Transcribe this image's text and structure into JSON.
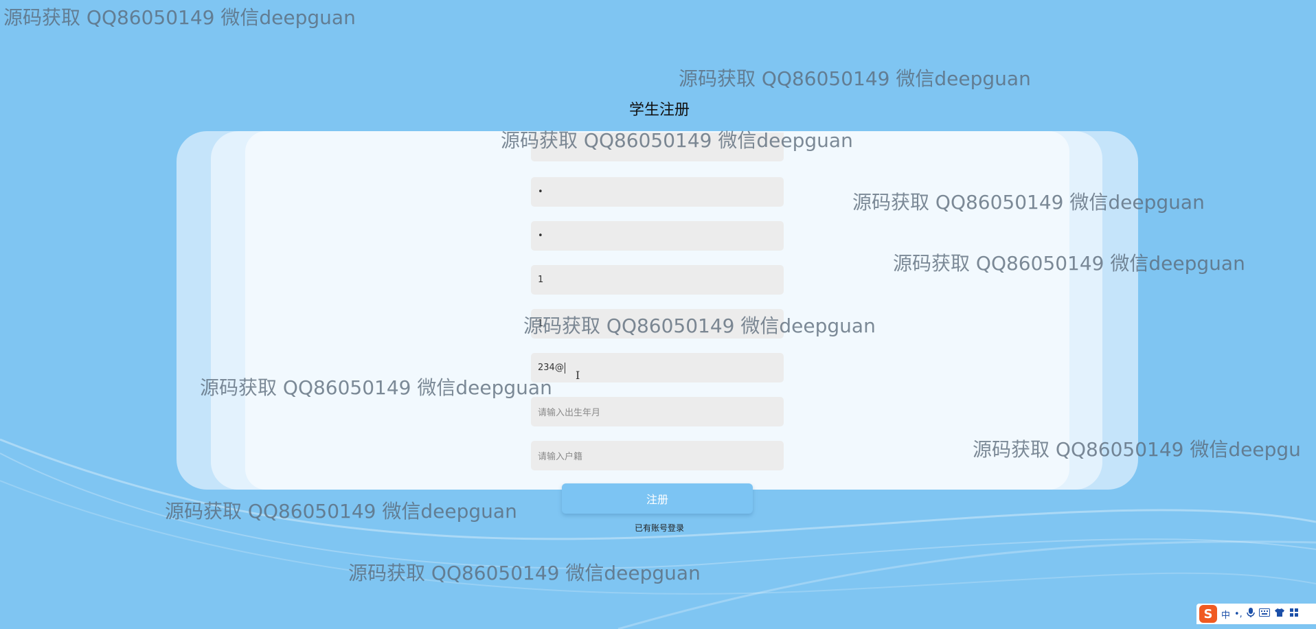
{
  "page": {
    "title": "学生注册"
  },
  "form": {
    "fields": [
      {
        "value": "",
        "placeholder": ""
      },
      {
        "value": "•",
        "placeholder": ""
      },
      {
        "value": "•",
        "placeholder": ""
      },
      {
        "value": "1",
        "placeholder": ""
      },
      {
        "value": "1",
        "placeholder": ""
      },
      {
        "value": "234@",
        "placeholder": ""
      },
      {
        "value": "",
        "placeholder": "请输入出生年月"
      },
      {
        "value": "",
        "placeholder": "请输入户籍"
      }
    ],
    "submit_label": "注册",
    "login_link": "已有账号登录"
  },
  "watermark": {
    "text": "源码获取 QQ86050149 微信deepguan",
    "text_cut": "源码获取 QQ86050149 微信deepgu"
  },
  "tray": {
    "ime_logo": "S",
    "ime_mode": "中",
    "punct": "•,",
    "mic_icon": "microphone-icon",
    "keyboard_icon": "keyboard-icon",
    "skin_icon": "shirt-icon",
    "menu_icon": "grid-icon"
  },
  "colors": {
    "background": "#7fc5f2",
    "button": "#7cc4f3",
    "field": "#ececec",
    "card": "#f2f9fe"
  }
}
